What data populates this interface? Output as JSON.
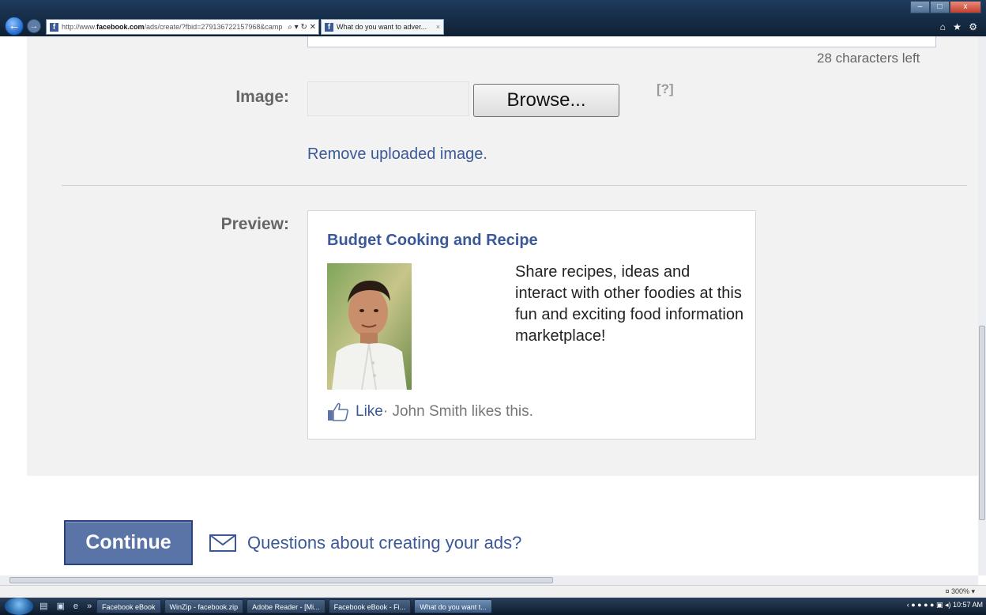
{
  "browser": {
    "url_prefix": "http://www.",
    "url_domain": "facebook.com",
    "url_rest": "/ads/create/?fbid=279136722157968&camp",
    "address_tools": "⌕ ▾ ↻ ✕",
    "tab_title": "What do you want to adver...",
    "tab_close": "×",
    "chrome_icons": "⌂ ★ ⚙",
    "win_min": "–",
    "win_max": "□",
    "win_close": "x"
  },
  "form": {
    "chars_left": "28 characters left",
    "image_label": "Image:",
    "browse_label": "Browse...",
    "help_label": "[?]",
    "remove_label": "Remove uploaded image.",
    "preview_label": "Preview:"
  },
  "ad": {
    "title": "Budget Cooking and Recipe",
    "body": "Share recipes, ideas and interact with other foodies at this fun and exciting food information marketplace!",
    "like_label": "Like",
    "like_text": "· John Smith likes this."
  },
  "footer": {
    "continue_label": "Continue",
    "questions_label": "Questions about creating your ads?"
  },
  "status": {
    "zoom": "¤ 300%  ▾"
  },
  "taskbar": {
    "quick_launch": "▤ ▣ e »",
    "items": [
      "Facebook eBook",
      "WinZip - facebook.zip",
      "Adobe Reader - [Mi...",
      "Facebook eBook - Fi...",
      "What do you want t..."
    ],
    "tray": "‹ ● ● ● ●  ▣ ◂) 10:57 AM"
  },
  "colors": {
    "link_blue": "#3b5998",
    "panel_gray": "#f2f2f2",
    "button_blue": "#5b74a8"
  }
}
